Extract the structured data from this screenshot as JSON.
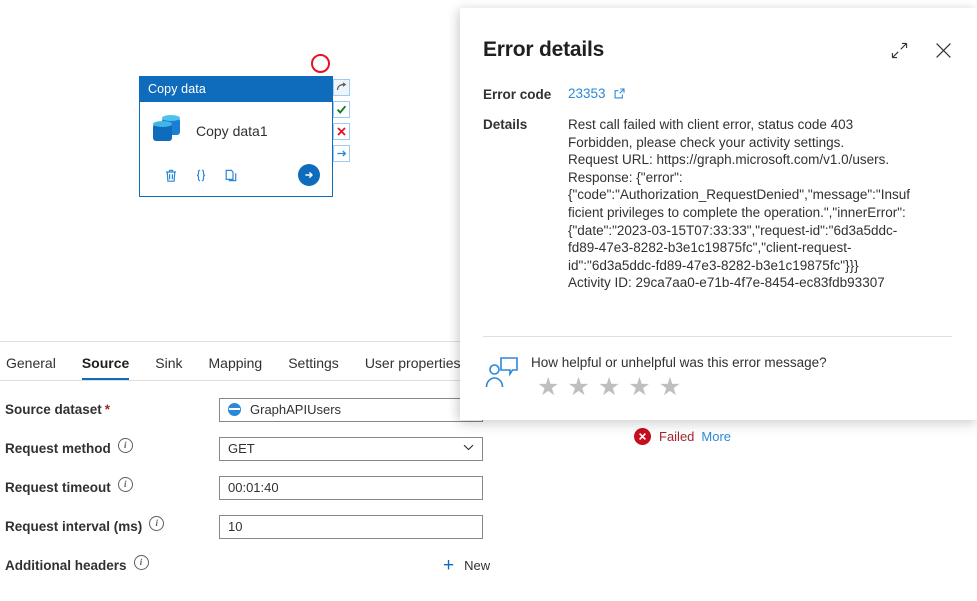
{
  "canvas": {
    "activity": {
      "header_label": "Copy data",
      "name": "Copy data1",
      "icon": "copy-data-cylinders-icon",
      "actions": [
        {
          "name": "delete-activity-button",
          "glyph": "trash-icon"
        },
        {
          "name": "code-view-button",
          "glyph": "curly-braces-icon"
        },
        {
          "name": "clone-activity-button",
          "glyph": "copy-icon"
        },
        {
          "name": "debug-run-button",
          "glyph": "arrow-right-circle-icon"
        }
      ],
      "handles": [
        {
          "name": "skip-dependency-handle",
          "label": "⤴"
        },
        {
          "name": "success-dependency-handle",
          "label": "✓"
        },
        {
          "name": "failure-dependency-handle",
          "label": "✕"
        },
        {
          "name": "completion-dependency-handle",
          "label": "→"
        }
      ],
      "error_marker": "red-error-circle"
    }
  },
  "tabs": [
    {
      "label": "General",
      "active": false
    },
    {
      "label": "Source",
      "active": true
    },
    {
      "label": "Sink",
      "active": false
    },
    {
      "label": "Mapping",
      "active": false
    },
    {
      "label": "Settings",
      "active": false
    },
    {
      "label": "User properties",
      "active": false
    }
  ],
  "form": {
    "rows": [
      {
        "label": "Source dataset",
        "required": true,
        "has_info": false,
        "control": "dataset",
        "value": "GraphAPIUsers"
      },
      {
        "label": "Request method",
        "required": false,
        "has_info": true,
        "control": "select",
        "value": "GET"
      },
      {
        "label": "Request timeout",
        "required": false,
        "has_info": true,
        "control": "text",
        "value": "00:01:40"
      },
      {
        "label": "Request interval (ms)",
        "required": false,
        "has_info": true,
        "control": "text",
        "value": "10"
      },
      {
        "label": "Additional headers",
        "required": false,
        "has_info": true,
        "control": "new-link",
        "value": "New"
      }
    ]
  },
  "status": {
    "icon": "error-circle-x-icon",
    "text": "Failed",
    "more_label": "More"
  },
  "error_panel": {
    "title": "Error details",
    "expand_icon": "expand-diagonal-icon",
    "close_icon": "close-icon",
    "error_code_key": "Error code",
    "error_code_value": "23353",
    "error_code_external_icon": "open-in-new-window-icon",
    "details_key": "Details",
    "details_value": "Rest call failed with client error, status code 403 Forbidden, please check your activity settings.\nRequest URL: https://graph.microsoft.com/v1.0/users.\nResponse: {\"error\":\n{\"code\":\"Authorization_RequestDenied\",\"message\":\"Insufficient privileges to complete the operation.\",\"innerError\":\n{\"date\":\"2023-03-15T07:33:33\",\"request-id\":\"6d3a5ddc-fd89-47e3-8282-b3e1c19875fc\",\"client-request-id\":\"6d3a5ddc-fd89-47e3-8282-b3e1c19875fc\"}}}\nActivity ID: 29ca7aa0-e71b-4f7e-8454-ec83fdb93307",
    "feedback": {
      "icon": "feedback-person-icon",
      "question": "How helpful or unhelpful was this error message?",
      "star_count": 5,
      "star_glyph": "★",
      "rating": 0
    }
  },
  "colors": {
    "accent_blue": "#0f6cbd",
    "link_blue": "#2b88d8",
    "error_red": "#c50f1f",
    "success_green": "#107c10",
    "failed_text": "#a4262c"
  }
}
